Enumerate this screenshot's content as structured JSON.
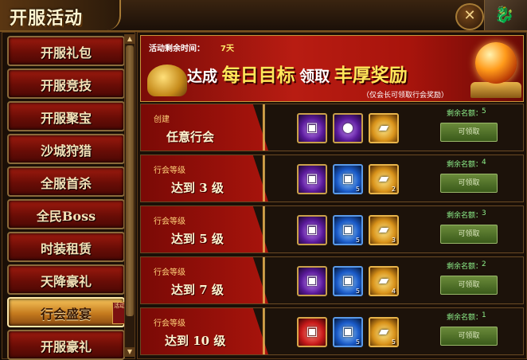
{
  "window": {
    "title": "开服活动"
  },
  "sidebar": {
    "items": [
      {
        "label": "开服礼包"
      },
      {
        "label": "开服竞技"
      },
      {
        "label": "开服聚宝"
      },
      {
        "label": "沙城狩猎"
      },
      {
        "label": "全服首杀"
      },
      {
        "label": "全民Boss"
      },
      {
        "label": "时装租赁"
      },
      {
        "label": "天降豪礼"
      },
      {
        "label": "行会盛宴",
        "active": true,
        "tag": "活动"
      },
      {
        "label": "开服豪礼"
      }
    ]
  },
  "banner": {
    "time_label": "活动剩余时间：",
    "time_value": "7天",
    "slogan_1": "达成",
    "slogan_2": "每日目标",
    "slogan_3": "领取",
    "slogan_4": "丰厚奖励",
    "note": "（仅会长可领取行会奖励）"
  },
  "rows": [
    {
      "sub": "创建",
      "main": "任意行会",
      "remain_label": "剩余名额：",
      "remain": "5",
      "button": "可领取",
      "rewards": [
        {
          "icon": "chest-icon",
          "color": "purple",
          "count": ""
        },
        {
          "icon": "orb-icon",
          "color": "purple",
          "count": ""
        },
        {
          "icon": "gold-ingot-icon",
          "color": "gold",
          "count": ""
        }
      ]
    },
    {
      "sub": "行会等级",
      "main": "达到 3 级",
      "remain_label": "剩余名额：",
      "remain": "4",
      "button": "可领取",
      "rewards": [
        {
          "icon": "chest-icon",
          "color": "purple",
          "count": ""
        },
        {
          "icon": "chest-icon",
          "color": "blue",
          "count": "5"
        },
        {
          "icon": "gold-ingot-icon",
          "color": "gold",
          "count": "2"
        }
      ]
    },
    {
      "sub": "行会等级",
      "main": "达到 5 级",
      "remain_label": "剩余名额：",
      "remain": "3",
      "button": "可领取",
      "rewards": [
        {
          "icon": "chest-icon",
          "color": "purple",
          "count": ""
        },
        {
          "icon": "chest-icon",
          "color": "blue",
          "count": "5"
        },
        {
          "icon": "gold-ingot-icon",
          "color": "gold",
          "count": "3"
        }
      ]
    },
    {
      "sub": "行会等级",
      "main": "达到 7 级",
      "remain_label": "剩余名额：",
      "remain": "2",
      "button": "可领取",
      "rewards": [
        {
          "icon": "chest-icon",
          "color": "purple",
          "count": ""
        },
        {
          "icon": "chest-icon",
          "color": "blue",
          "count": "5"
        },
        {
          "icon": "gold-ingot-icon",
          "color": "gold",
          "count": "4"
        }
      ]
    },
    {
      "sub": "行会等级",
      "main": "达到 10 级",
      "remain_label": "剩余名额：",
      "remain": "1",
      "button": "可领取",
      "rewards": [
        {
          "icon": "chest-icon",
          "color": "red",
          "count": ""
        },
        {
          "icon": "chest-icon",
          "color": "blue",
          "count": "5"
        },
        {
          "icon": "gold-ingot-icon",
          "color": "gold",
          "count": "5"
        }
      ]
    }
  ]
}
